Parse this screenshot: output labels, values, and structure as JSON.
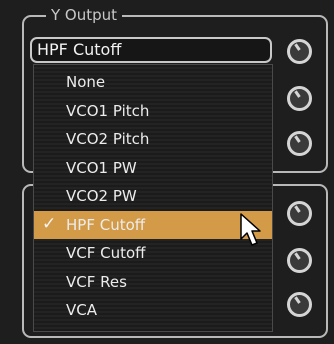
{
  "group_top": {
    "legend": "Y Output",
    "combo_value": "HPF Cutoff"
  },
  "dropdown": {
    "items": [
      {
        "label": "None",
        "selected": false
      },
      {
        "label": "VCO1 Pitch",
        "selected": false
      },
      {
        "label": "VCO2 Pitch",
        "selected": false
      },
      {
        "label": "VCO1 PW",
        "selected": false
      },
      {
        "label": "VCO2 PW",
        "selected": false
      },
      {
        "label": "HPF Cutoff",
        "selected": true
      },
      {
        "label": "VCF Cutoff",
        "selected": false
      },
      {
        "label": "VCF Res",
        "selected": false
      },
      {
        "label": "VCA",
        "selected": false
      }
    ],
    "check_glyph": "✓",
    "selection_color": "#d39b48"
  },
  "icons": {
    "knob": "knob-icon",
    "check": "checkmark-icon",
    "cursor": "mouse-pointer-icon"
  }
}
